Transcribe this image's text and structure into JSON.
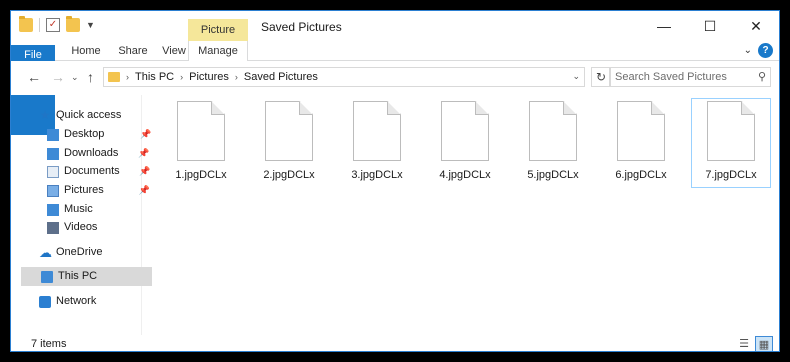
{
  "window": {
    "title": "Saved Pictures",
    "context_tab_group": "Picture Tools"
  },
  "ribbon": {
    "tabs": [
      "File",
      "Home",
      "Share",
      "View",
      "Manage"
    ]
  },
  "controls": {
    "minimize": "—",
    "maximize": "☐",
    "close": "✕"
  },
  "address": {
    "segments": [
      "This PC",
      "Pictures",
      "Saved Pictures"
    ]
  },
  "search": {
    "placeholder": "Search Saved Pictures"
  },
  "sidebar": {
    "items": [
      {
        "label": "Quick access",
        "icon": "star-icon"
      },
      {
        "label": "Desktop",
        "icon": "desktop-icon",
        "pinned": true
      },
      {
        "label": "Downloads",
        "icon": "downloads-icon",
        "pinned": true
      },
      {
        "label": "Documents",
        "icon": "documents-icon",
        "pinned": true
      },
      {
        "label": "Pictures",
        "icon": "pictures-icon",
        "pinned": true
      },
      {
        "label": "Music",
        "icon": "music-icon"
      },
      {
        "label": "Videos",
        "icon": "videos-icon"
      },
      {
        "label": "OneDrive",
        "icon": "onedrive-icon"
      },
      {
        "label": "This PC",
        "icon": "this-pc-icon",
        "selected": true
      },
      {
        "label": "Network",
        "icon": "network-icon"
      }
    ]
  },
  "files": [
    {
      "name": "1.jpgDCLx"
    },
    {
      "name": "2.jpgDCLx"
    },
    {
      "name": "3.jpgDCLx"
    },
    {
      "name": "4.jpgDCLx"
    },
    {
      "name": "5.jpgDCLx"
    },
    {
      "name": "6.jpgDCLx"
    },
    {
      "name": "7.jpgDCLx",
      "selected": true
    }
  ],
  "status": {
    "item_count": "7 items"
  },
  "colors": {
    "accent": "#1979ca",
    "context_tab": "#f5e79a",
    "selection_border": "#99d1ff"
  }
}
